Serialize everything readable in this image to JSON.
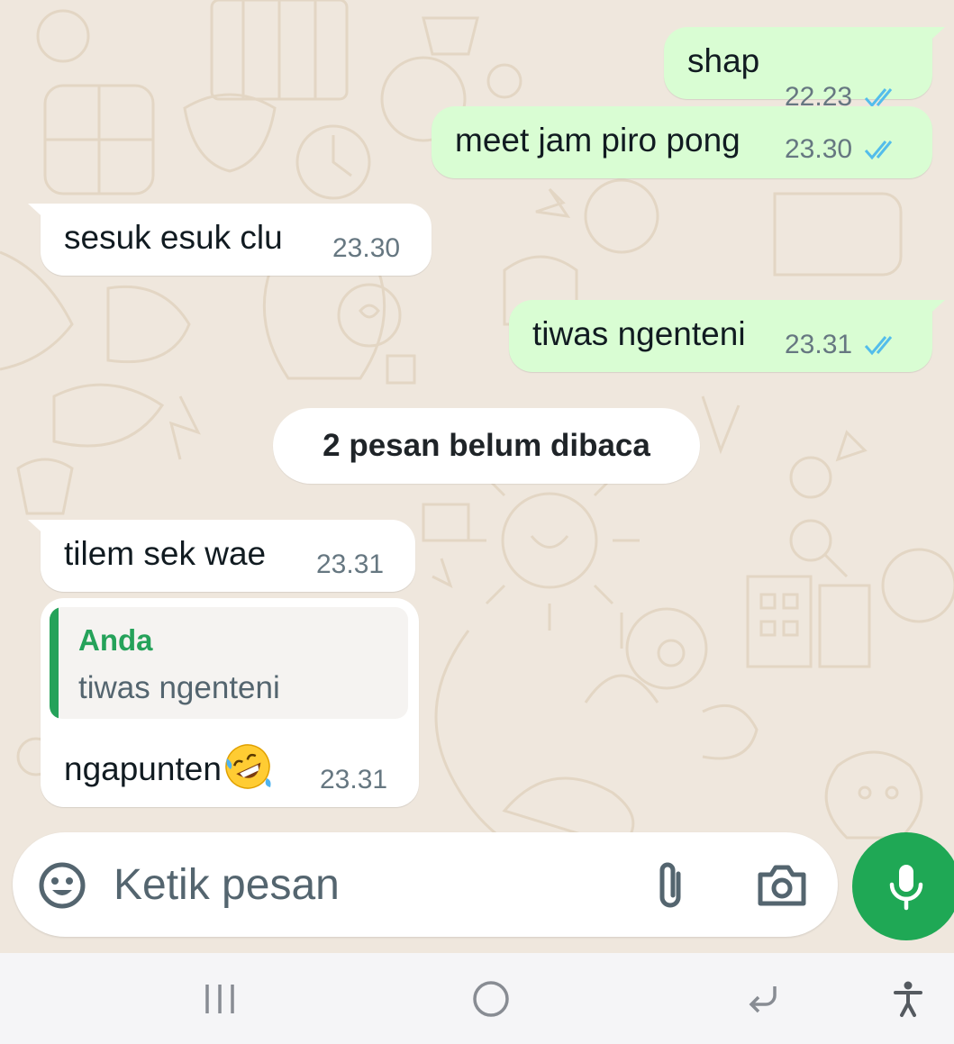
{
  "chat": {
    "messages": [
      {
        "direction": "outgoing",
        "text": "shap",
        "time": "22.23",
        "status": "read"
      },
      {
        "direction": "outgoing",
        "text": "meet jam piro pong",
        "time": "23.30",
        "status": "read"
      },
      {
        "direction": "incoming",
        "text": "sesuk esuk clu",
        "time": "23.30"
      },
      {
        "direction": "outgoing",
        "text": "tiwas ngenteni",
        "time": "23.31",
        "status": "read"
      },
      {
        "direction": "incoming",
        "text": "tilem sek wae",
        "time": "23.31"
      },
      {
        "direction": "incoming",
        "text": "ngapunten",
        "emoji": "rolling-on-floor-laughing",
        "time": "23.31",
        "quoted": {
          "author": "Anda",
          "text": "tiwas ngenteni"
        }
      }
    ],
    "unread_divider": "2 pesan belum dibaca"
  },
  "composer": {
    "placeholder": "Ketik pesan",
    "emoji_icon": "smiley-icon",
    "attach_icon": "paperclip-icon",
    "camera_icon": "camera-icon",
    "mic_icon": "microphone-icon"
  },
  "system_nav": {
    "buttons": [
      "recent-apps-icon",
      "home-icon",
      "back-icon",
      "accessibility-icon"
    ]
  },
  "colors": {
    "outgoing_bubble": "#d9fdd3",
    "incoming_bubble": "#ffffff",
    "read_ticks": "#53bdeb",
    "accent_green": "#1fa855",
    "chat_background": "#efe7dd"
  }
}
